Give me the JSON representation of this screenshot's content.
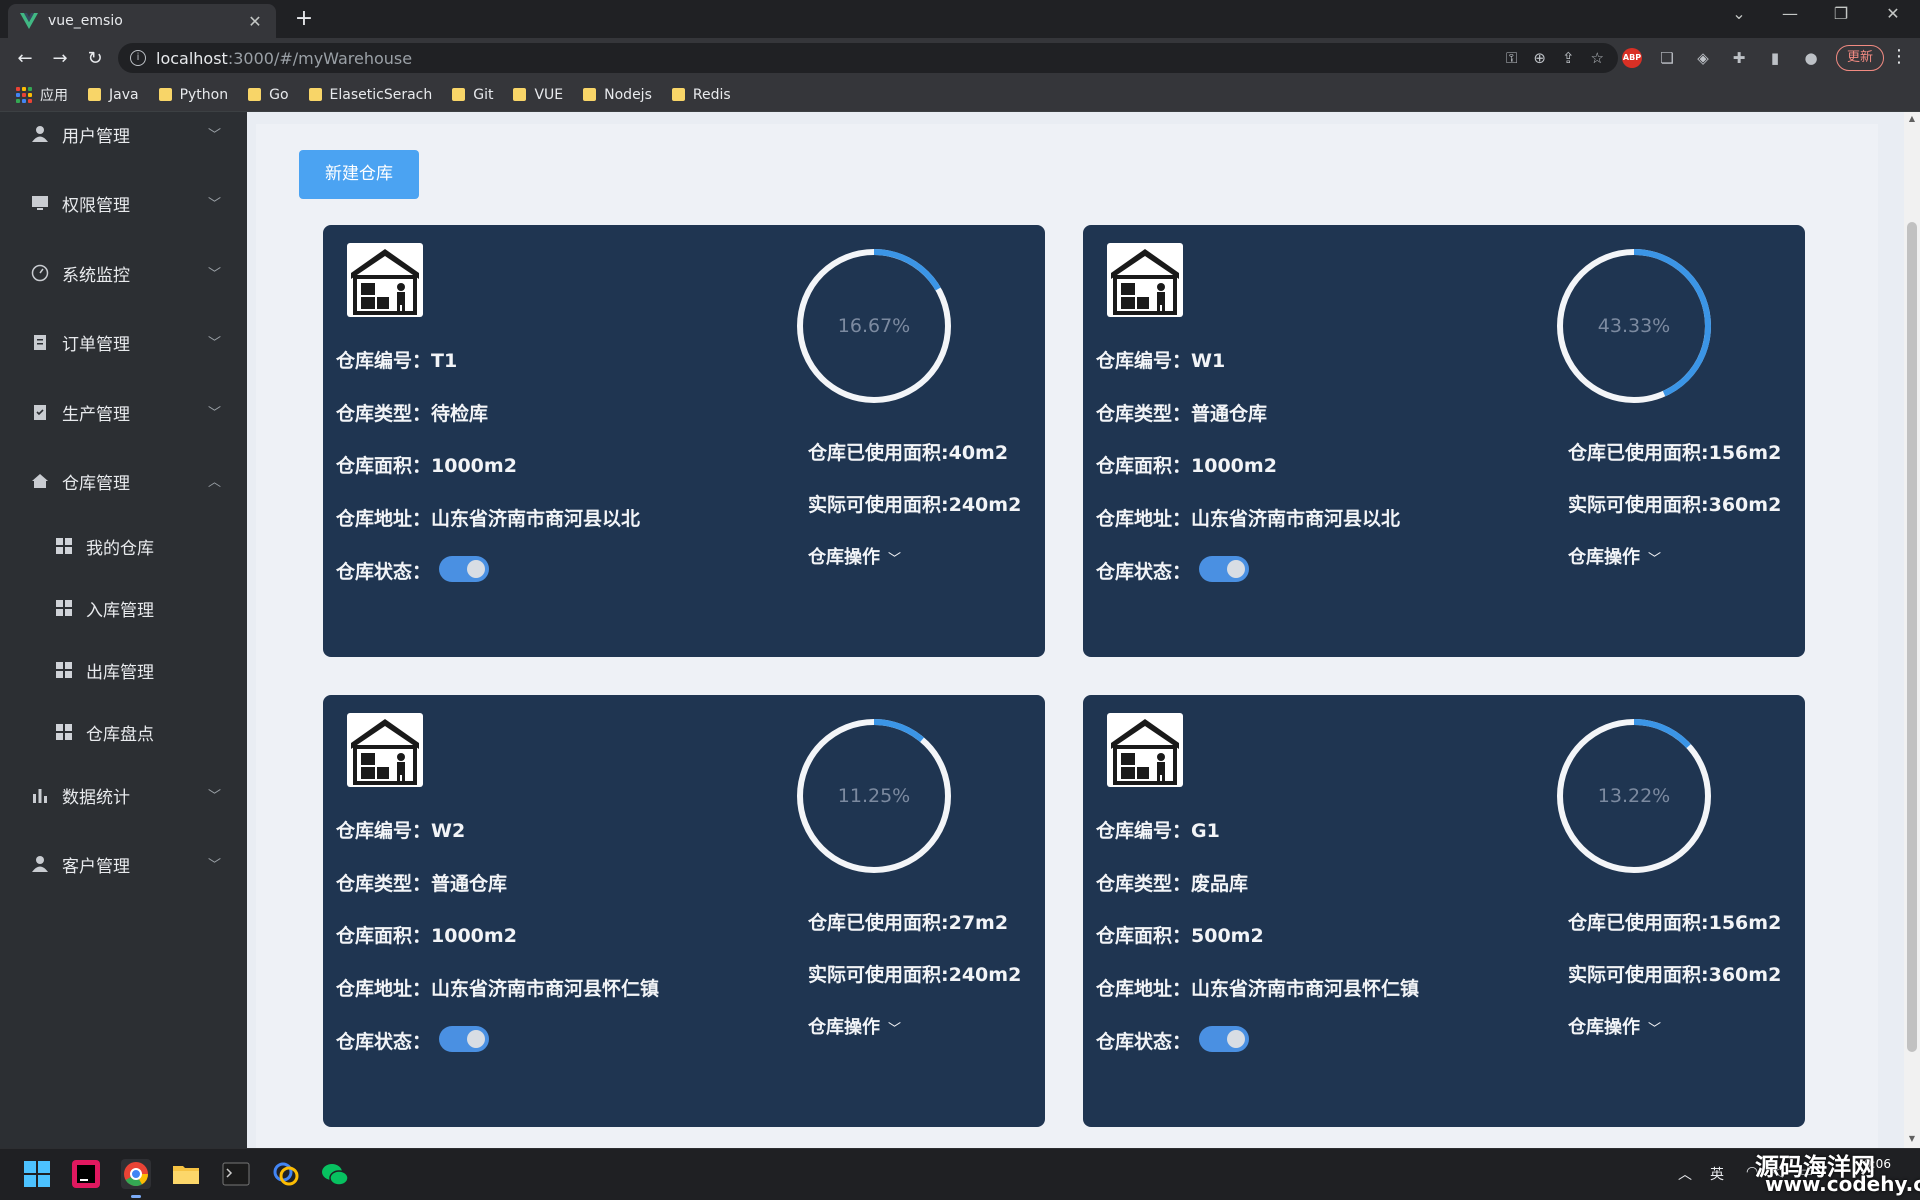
{
  "browser": {
    "tab_title": "vue_emsio",
    "new_tab": "+",
    "url_host": "localhost",
    "url_rest": ":3000/#/myWarehouse",
    "update_label": "更新",
    "bookmarks": [
      "应用",
      "Java",
      "Python",
      "Go",
      "ElaseticSerach",
      "Git",
      "VUE",
      "Nodejs",
      "Redis"
    ]
  },
  "sidebar": {
    "menus": [
      {
        "label": "用户管理",
        "icon": "user-icon",
        "expanded": false
      },
      {
        "label": "权限管理",
        "icon": "monitor-icon",
        "expanded": false
      },
      {
        "label": "系统监控",
        "icon": "gauge-icon",
        "expanded": false
      },
      {
        "label": "订单管理",
        "icon": "clipboard-icon",
        "expanded": false
      },
      {
        "label": "生产管理",
        "icon": "checklist-icon",
        "expanded": false
      },
      {
        "label": "仓库管理",
        "icon": "home-icon",
        "expanded": true
      },
      {
        "label": "数据统计",
        "icon": "bar-chart-icon",
        "expanded": false
      },
      {
        "label": "客户管理",
        "icon": "user-icon",
        "expanded": false
      }
    ],
    "submenus": [
      "我的仓库",
      "入库管理",
      "出库管理",
      "仓库盘点"
    ]
  },
  "main": {
    "new_button": "新建仓库",
    "labels": {
      "code": "仓库编号：",
      "type": "仓库类型：",
      "area": "仓库面积：",
      "address": "仓库地址：",
      "status": "仓库状态：",
      "used": "仓库已使用面积:",
      "available": "实际可使用面积:",
      "ops": "仓库操作"
    },
    "cards": [
      {
        "code": "T1",
        "type": "待检库",
        "area": "1000m2",
        "address": "山东省济南市商河县以北",
        "status_on": true,
        "percent": "16.67%",
        "ratio": 0.1667,
        "used": "40m2",
        "available": "240m2"
      },
      {
        "code": "W1",
        "type": "普通仓库",
        "area": "1000m2",
        "address": "山东省济南市商河县以北",
        "status_on": true,
        "percent": "43.33%",
        "ratio": 0.4333,
        "used": "156m2",
        "available": "360m2"
      },
      {
        "code": "W2",
        "type": "普通仓库",
        "area": "1000m2",
        "address": "山东省济南市商河县怀仁镇",
        "status_on": true,
        "percent": "11.25%",
        "ratio": 0.1125,
        "used": "27m2",
        "available": "240m2"
      },
      {
        "code": "G1",
        "type": "废品库",
        "area": "500m2",
        "address": "山东省济南市商河县怀仁镇",
        "status_on": true,
        "percent": "13.22%",
        "ratio": 0.1322,
        "used": "156m2",
        "available": "360m2"
      }
    ]
  },
  "taskbar": {
    "tray_lang": "英",
    "time": "9:06"
  },
  "watermark": {
    "line1": "源码海洋网",
    "line2": "www.codehy.com"
  },
  "colors": {
    "card_bg": "#1f3551",
    "accent": "#4ba3f2",
    "ring_progress": "#3b95e6",
    "ring_track": "#f3f5f8",
    "sidebar_bg": "#2c2f33"
  }
}
